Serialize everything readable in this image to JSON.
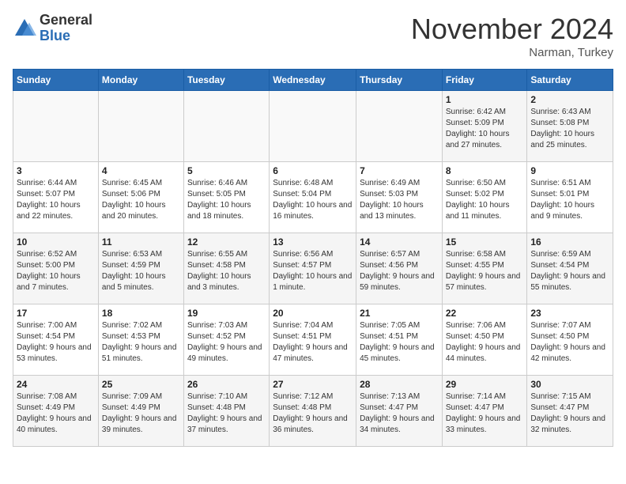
{
  "header": {
    "logo_general": "General",
    "logo_blue": "Blue",
    "month_title": "November 2024",
    "location": "Narman, Turkey"
  },
  "weekdays": [
    "Sunday",
    "Monday",
    "Tuesday",
    "Wednesday",
    "Thursday",
    "Friday",
    "Saturday"
  ],
  "weeks": [
    [
      {
        "day": "",
        "info": ""
      },
      {
        "day": "",
        "info": ""
      },
      {
        "day": "",
        "info": ""
      },
      {
        "day": "",
        "info": ""
      },
      {
        "day": "",
        "info": ""
      },
      {
        "day": "1",
        "info": "Sunrise: 6:42 AM\nSunset: 5:09 PM\nDaylight: 10 hours and 27 minutes."
      },
      {
        "day": "2",
        "info": "Sunrise: 6:43 AM\nSunset: 5:08 PM\nDaylight: 10 hours and 25 minutes."
      }
    ],
    [
      {
        "day": "3",
        "info": "Sunrise: 6:44 AM\nSunset: 5:07 PM\nDaylight: 10 hours and 22 minutes."
      },
      {
        "day": "4",
        "info": "Sunrise: 6:45 AM\nSunset: 5:06 PM\nDaylight: 10 hours and 20 minutes."
      },
      {
        "day": "5",
        "info": "Sunrise: 6:46 AM\nSunset: 5:05 PM\nDaylight: 10 hours and 18 minutes."
      },
      {
        "day": "6",
        "info": "Sunrise: 6:48 AM\nSunset: 5:04 PM\nDaylight: 10 hours and 16 minutes."
      },
      {
        "day": "7",
        "info": "Sunrise: 6:49 AM\nSunset: 5:03 PM\nDaylight: 10 hours and 13 minutes."
      },
      {
        "day": "8",
        "info": "Sunrise: 6:50 AM\nSunset: 5:02 PM\nDaylight: 10 hours and 11 minutes."
      },
      {
        "day": "9",
        "info": "Sunrise: 6:51 AM\nSunset: 5:01 PM\nDaylight: 10 hours and 9 minutes."
      }
    ],
    [
      {
        "day": "10",
        "info": "Sunrise: 6:52 AM\nSunset: 5:00 PM\nDaylight: 10 hours and 7 minutes."
      },
      {
        "day": "11",
        "info": "Sunrise: 6:53 AM\nSunset: 4:59 PM\nDaylight: 10 hours and 5 minutes."
      },
      {
        "day": "12",
        "info": "Sunrise: 6:55 AM\nSunset: 4:58 PM\nDaylight: 10 hours and 3 minutes."
      },
      {
        "day": "13",
        "info": "Sunrise: 6:56 AM\nSunset: 4:57 PM\nDaylight: 10 hours and 1 minute."
      },
      {
        "day": "14",
        "info": "Sunrise: 6:57 AM\nSunset: 4:56 PM\nDaylight: 9 hours and 59 minutes."
      },
      {
        "day": "15",
        "info": "Sunrise: 6:58 AM\nSunset: 4:55 PM\nDaylight: 9 hours and 57 minutes."
      },
      {
        "day": "16",
        "info": "Sunrise: 6:59 AM\nSunset: 4:54 PM\nDaylight: 9 hours and 55 minutes."
      }
    ],
    [
      {
        "day": "17",
        "info": "Sunrise: 7:00 AM\nSunset: 4:54 PM\nDaylight: 9 hours and 53 minutes."
      },
      {
        "day": "18",
        "info": "Sunrise: 7:02 AM\nSunset: 4:53 PM\nDaylight: 9 hours and 51 minutes."
      },
      {
        "day": "19",
        "info": "Sunrise: 7:03 AM\nSunset: 4:52 PM\nDaylight: 9 hours and 49 minutes."
      },
      {
        "day": "20",
        "info": "Sunrise: 7:04 AM\nSunset: 4:51 PM\nDaylight: 9 hours and 47 minutes."
      },
      {
        "day": "21",
        "info": "Sunrise: 7:05 AM\nSunset: 4:51 PM\nDaylight: 9 hours and 45 minutes."
      },
      {
        "day": "22",
        "info": "Sunrise: 7:06 AM\nSunset: 4:50 PM\nDaylight: 9 hours and 44 minutes."
      },
      {
        "day": "23",
        "info": "Sunrise: 7:07 AM\nSunset: 4:50 PM\nDaylight: 9 hours and 42 minutes."
      }
    ],
    [
      {
        "day": "24",
        "info": "Sunrise: 7:08 AM\nSunset: 4:49 PM\nDaylight: 9 hours and 40 minutes."
      },
      {
        "day": "25",
        "info": "Sunrise: 7:09 AM\nSunset: 4:49 PM\nDaylight: 9 hours and 39 minutes."
      },
      {
        "day": "26",
        "info": "Sunrise: 7:10 AM\nSunset: 4:48 PM\nDaylight: 9 hours and 37 minutes."
      },
      {
        "day": "27",
        "info": "Sunrise: 7:12 AM\nSunset: 4:48 PM\nDaylight: 9 hours and 36 minutes."
      },
      {
        "day": "28",
        "info": "Sunrise: 7:13 AM\nSunset: 4:47 PM\nDaylight: 9 hours and 34 minutes."
      },
      {
        "day": "29",
        "info": "Sunrise: 7:14 AM\nSunset: 4:47 PM\nDaylight: 9 hours and 33 minutes."
      },
      {
        "day": "30",
        "info": "Sunrise: 7:15 AM\nSunset: 4:47 PM\nDaylight: 9 hours and 32 minutes."
      }
    ]
  ]
}
